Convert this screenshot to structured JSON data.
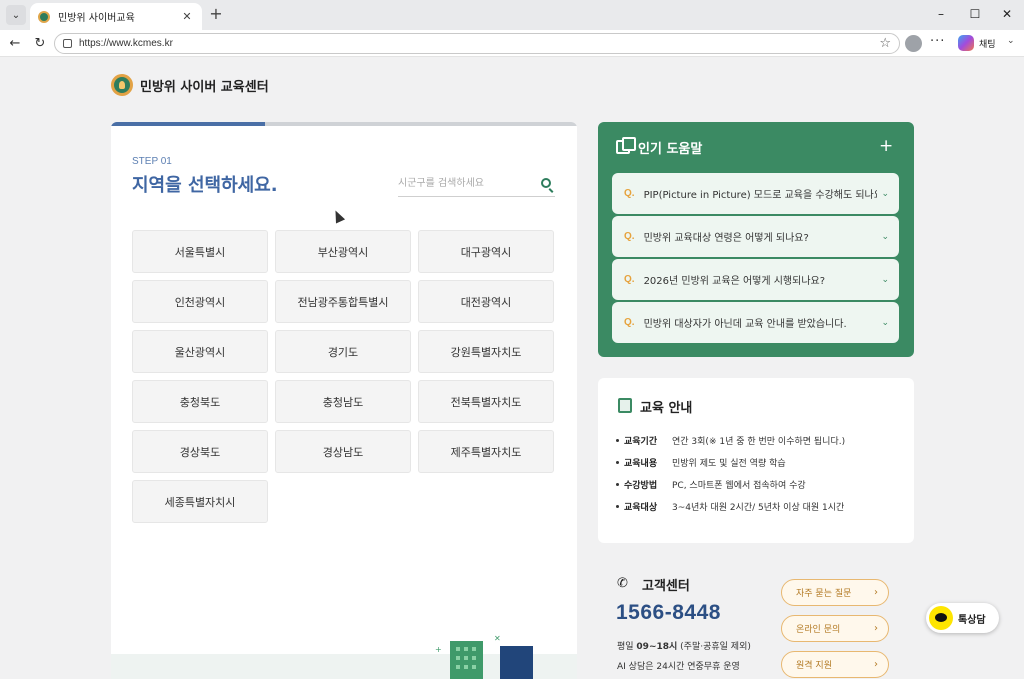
{
  "browser": {
    "tab_title": "민방위 사이버교육",
    "url": "https://www.kcmes.kr",
    "chat_label": "채팅"
  },
  "site": {
    "logo_text": "민방위 사이버 교육센터",
    "colors": {
      "primary_green": "#3b8a63",
      "accent_orange": "#e6a23c",
      "title_blue": "#3f66a3",
      "phone_navy": "#2c4f84"
    }
  },
  "step": {
    "progress_percent": 33,
    "label": "STEP 01",
    "title": "지역을 선택하세요.",
    "search_placeholder": "시군구를 검색하세요",
    "search_icon": "search-icon"
  },
  "regions": [
    "서울특별시",
    "부산광역시",
    "대구광역시",
    "인천광역시",
    "전남광주통합특별시",
    "대전광역시",
    "울산광역시",
    "경기도",
    "강원특별자치도",
    "충청북도",
    "충청남도",
    "전북특별자치도",
    "경상북도",
    "경상남도",
    "제주특별자치도",
    "세종특별자치시"
  ],
  "faq": {
    "title": "인기 도움말",
    "q_marker": "Q.",
    "items": [
      "PIP(Picture in Picture) 모드로 교육을 수강해도 되나요?",
      "민방위 교육대상 연령은 어떻게 되나요?",
      "2026년 민방위 교육은 어떻게 시행되나요?",
      "민방위 대상자가 아닌데 교육 안내를 받았습니다."
    ]
  },
  "education": {
    "title": "교육 안내",
    "rows": [
      {
        "key": "교육기간",
        "value": "연간 3회(※ 1년 중 한 번만 이수하면 됩니다.)"
      },
      {
        "key": "교육내용",
        "value": "민방위 제도 및 실전 역량 학습"
      },
      {
        "key": "수강방법",
        "value": "PC, 스마트폰 웹에서 접속하여 수강"
      },
      {
        "key": "교육대상",
        "value": "3~4년차 대원 2시간/ 5년차 이상 대원 1시간"
      }
    ]
  },
  "customer_center": {
    "title": "고객센터",
    "phone": "1566-8448",
    "hours_prefix": "평일 ",
    "hours_time": "09~18시",
    "hours_suffix": " (주말·공휴일 제외)",
    "ai_note": "AI 상담은 24시간 연중무휴 운영",
    "buttons": [
      "자주 묻는 질문",
      "온라인 문의",
      "원격 지원"
    ]
  },
  "talk_button": {
    "label": "톡상담"
  }
}
